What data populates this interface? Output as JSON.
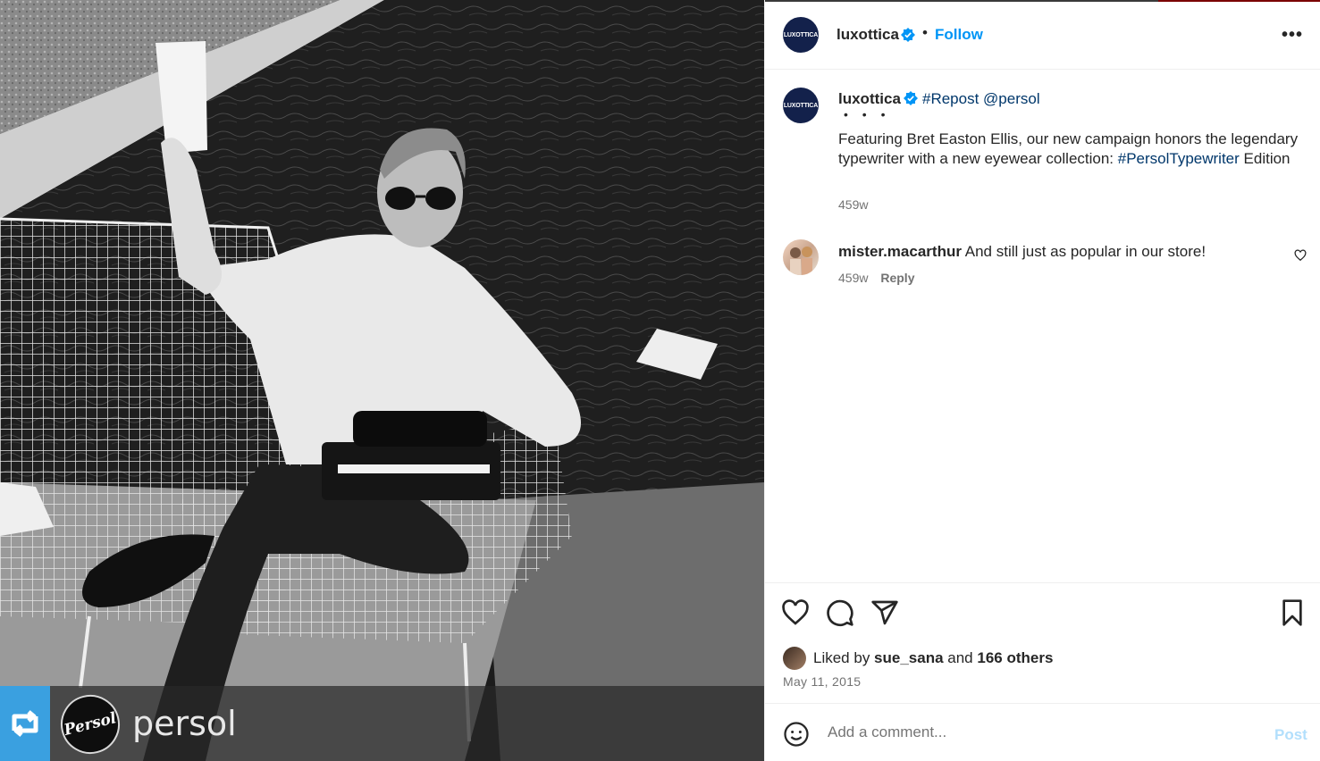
{
  "photo": {
    "watermark_name": "persol",
    "logo_text": "Persol"
  },
  "header": {
    "username": "luxottica",
    "avatar_text": "LUXOTTICA",
    "separator": "•",
    "follow_label": "Follow",
    "more_label": "•••"
  },
  "caption": {
    "username": "luxottica",
    "tags": "#Repost @persol",
    "dots": "• • •",
    "text_before": "Featuring Bret Easton Ellis, our new campaign honors the legendary typewriter with a new eyewear collection: ",
    "hashtag": "#PersolTypewriter",
    "text_after": " Edition",
    "time": "459w"
  },
  "comments": [
    {
      "username": "mister.macarthur",
      "text": "And still just as popular in our store!",
      "time": "459w",
      "reply_label": "Reply"
    }
  ],
  "likes": {
    "prefix": "Liked by ",
    "user": "sue_sana",
    "middle": " and ",
    "others": "166 others"
  },
  "date": "May 11, 2015",
  "comment_input": {
    "placeholder": "Add a comment...",
    "post_label": "Post"
  },
  "colors": {
    "link_blue": "#0095f6",
    "hashtag_blue": "#00376b",
    "verified_blue": "#0095f6",
    "repost_blue": "#3aa0e0"
  }
}
